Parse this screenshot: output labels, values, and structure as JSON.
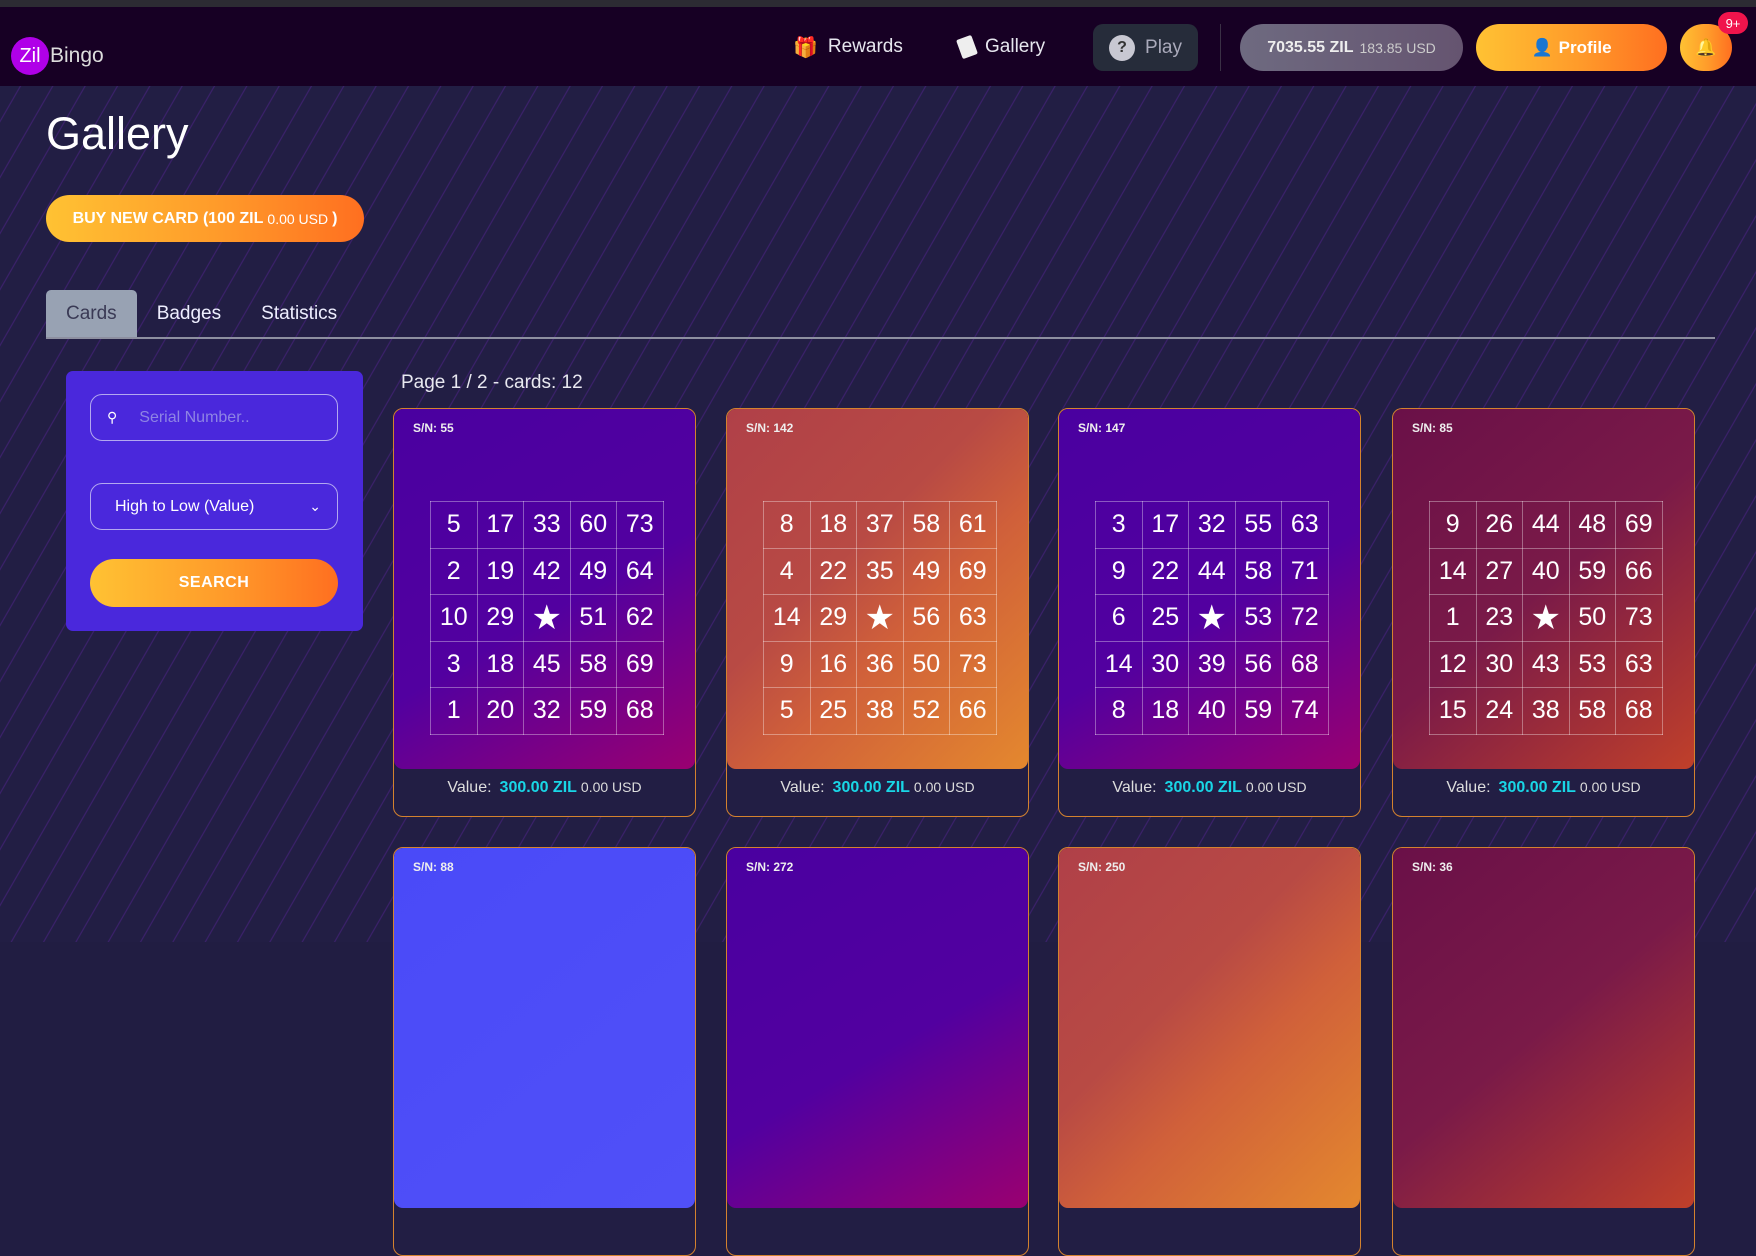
{
  "header": {
    "logo": {
      "zil": "Zil",
      "bingo": "Bingo"
    },
    "nav": [
      {
        "label": "Rewards",
        "icon": "gift-icon"
      },
      {
        "label": "Gallery",
        "icon": "cards-icon"
      }
    ],
    "play_label": "Play",
    "balance": {
      "zil": "7035.55 ZIL",
      "usd": "183.85 USD"
    },
    "profile_label": "Profile",
    "notification_badge": "9+"
  },
  "page": {
    "title": "Gallery",
    "buy_button": {
      "label": "BUY NEW CARD (100 ZIL",
      "usd": "0.00 USD",
      "close": ")"
    },
    "tabs": [
      {
        "label": "Cards",
        "active": true
      },
      {
        "label": "Badges"
      },
      {
        "label": "Statistics"
      }
    ],
    "filter": {
      "search_placeholder": "Serial Number..",
      "sort_selected": "High to Low (Value)",
      "search_button": "SEARCH"
    },
    "page_info": "Page 1 / 2  - cards: 12",
    "value_label": "Value:"
  },
  "colors": {
    "accent_cyan": "#19d6e6",
    "orange": "#ff9a2a",
    "panel": "#4a28dc"
  },
  "cards": [
    {
      "sn": "S/N: 55",
      "theme": "purple",
      "value_zil": "300.00 ZIL",
      "value_usd": "0.00 USD",
      "grid": [
        [
          5,
          17,
          33,
          60,
          73
        ],
        [
          2,
          19,
          42,
          49,
          64
        ],
        [
          10,
          29,
          "★",
          51,
          62
        ],
        [
          3,
          18,
          45,
          58,
          69
        ],
        [
          1,
          20,
          32,
          59,
          68
        ]
      ]
    },
    {
      "sn": "S/N: 142",
      "theme": "orange",
      "value_zil": "300.00 ZIL",
      "value_usd": "0.00 USD",
      "grid": [
        [
          8,
          18,
          37,
          58,
          61
        ],
        [
          4,
          22,
          35,
          49,
          69
        ],
        [
          14,
          29,
          "★",
          56,
          63
        ],
        [
          9,
          16,
          36,
          50,
          73
        ],
        [
          5,
          25,
          38,
          52,
          66
        ]
      ]
    },
    {
      "sn": "S/N: 147",
      "theme": "purple",
      "value_zil": "300.00 ZIL",
      "value_usd": "0.00 USD",
      "grid": [
        [
          3,
          17,
          32,
          55,
          63
        ],
        [
          9,
          22,
          44,
          58,
          71
        ],
        [
          6,
          25,
          "★",
          53,
          72
        ],
        [
          14,
          30,
          39,
          56,
          68
        ],
        [
          8,
          18,
          40,
          59,
          74
        ]
      ]
    },
    {
      "sn": "S/N: 85",
      "theme": "magenta",
      "value_zil": "300.00 ZIL",
      "value_usd": "0.00 USD",
      "grid": [
        [
          9,
          26,
          44,
          48,
          69
        ],
        [
          14,
          27,
          40,
          59,
          66
        ],
        [
          1,
          23,
          "★",
          50,
          73
        ],
        [
          12,
          30,
          43,
          53,
          63
        ],
        [
          15,
          24,
          38,
          58,
          68
        ]
      ]
    },
    {
      "sn": "S/N: 88",
      "theme": "blue"
    },
    {
      "sn": "S/N: 272",
      "theme": "purple"
    },
    {
      "sn": "S/N: 250",
      "theme": "orange"
    },
    {
      "sn": "S/N: 36",
      "theme": "magenta"
    }
  ]
}
